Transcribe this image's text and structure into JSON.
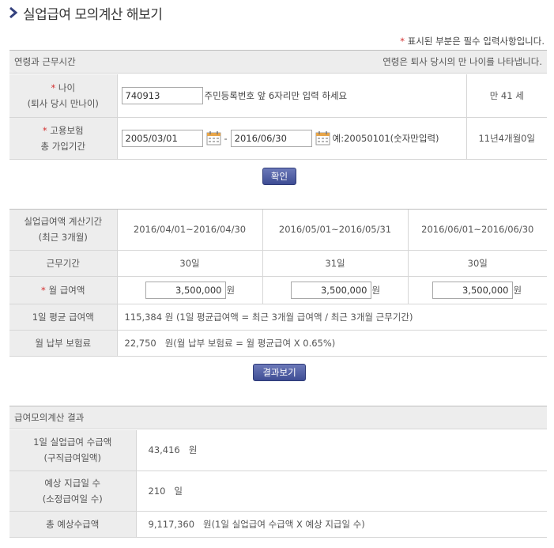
{
  "title": "실업급여 모의계산 해보기",
  "required_note": "표시된 부분은 필수 입력사항입니다.",
  "required_mark": "*",
  "section1": {
    "header_left": "연령과 근무시간",
    "header_right": "연령은 퇴사 당시의 만 나이를 나타냅니다.",
    "age": {
      "label_line1": "나이",
      "label_line2": "(퇴사 당시 만나이)",
      "input_value": "740913",
      "hint": "주민등록번호 앞 6자리만 입력 하세요",
      "result": "만 41 세"
    },
    "period": {
      "label_line1": "고용보험",
      "label_line2": "총 가입기간",
      "start_value": "2005/03/01",
      "separator": "-",
      "end_value": "2016/06/30",
      "hint": "예:20050101(숫자만입력)",
      "result": "11년4개월0일"
    },
    "confirm_button": "확인"
  },
  "section2": {
    "period_label_line1": "실업급여액 계산기간",
    "period_label_line2": "(최근 3개월)",
    "periods": [
      "2016/04/01~2016/04/30",
      "2016/05/01~2016/05/31",
      "2016/06/01~2016/06/30"
    ],
    "work_days_label": "근무기간",
    "work_days": [
      "30일",
      "31일",
      "30일"
    ],
    "salary_label": "월 급여액",
    "salaries": [
      "3,500,000",
      "3,500,000",
      "3,500,000"
    ],
    "won": "원",
    "daily_avg_label": "1일 평균 급여액",
    "daily_avg_value": "115,384 원 (1일 평균급여액 = 최근 3개월 급여액 / 최근 3개월 근무기간)",
    "premium_label": "월 납부 보험료",
    "premium_value": "22,750   원(월 납부 보험료 = 월 평균급여 X 0.65%)",
    "result_button": "결과보기"
  },
  "section3": {
    "header": "급여모의계산 결과",
    "daily_benefit_label_line1": "1일 실업급여 수급액",
    "daily_benefit_label_line2": "(구직급여일액)",
    "daily_benefit_value": "43,416   원",
    "days_label_line1": "예상 지급일 수",
    "days_label_line2": "(소정급여일 수)",
    "days_value": "210   일",
    "total_label": "총 예상수급액",
    "total_value": "9,117,360   원(1일 실업급여 수급액 X 예상 지급일 수)"
  },
  "colors": {
    "accent": "#3e4d94",
    "required": "#d32f2f",
    "header_bg": "#ededed"
  },
  "icons": [
    "chevron-right-icon",
    "calendar-icon"
  ]
}
